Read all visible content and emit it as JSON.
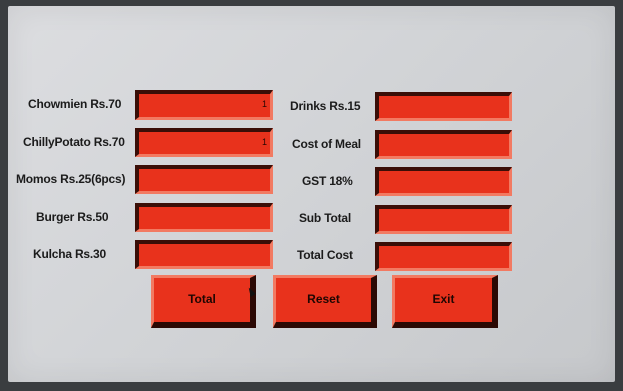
{
  "left_items": [
    {
      "label": "Chowmien  Rs.70",
      "value": "1"
    },
    {
      "label": "ChillyPotato Rs.70",
      "value": "1"
    },
    {
      "label": "Momos  Rs.25(6pcs)",
      "value": ""
    },
    {
      "label": "Burger Rs.50",
      "value": ""
    },
    {
      "label": "Kulcha  Rs.30",
      "value": ""
    }
  ],
  "right_items": [
    {
      "label": "Drinks  Rs.15",
      "value": ""
    },
    {
      "label": "Cost of Meal",
      "value": ""
    },
    {
      "label": "GST 18%",
      "value": ""
    },
    {
      "label": "Sub Total",
      "value": ""
    },
    {
      "label": "Total Cost",
      "value": ""
    }
  ],
  "buttons": {
    "total": "Total",
    "reset": "Reset",
    "exit": "Exit"
  },
  "colors": {
    "field": "#e8321c",
    "background": "#d4d6d9"
  }
}
